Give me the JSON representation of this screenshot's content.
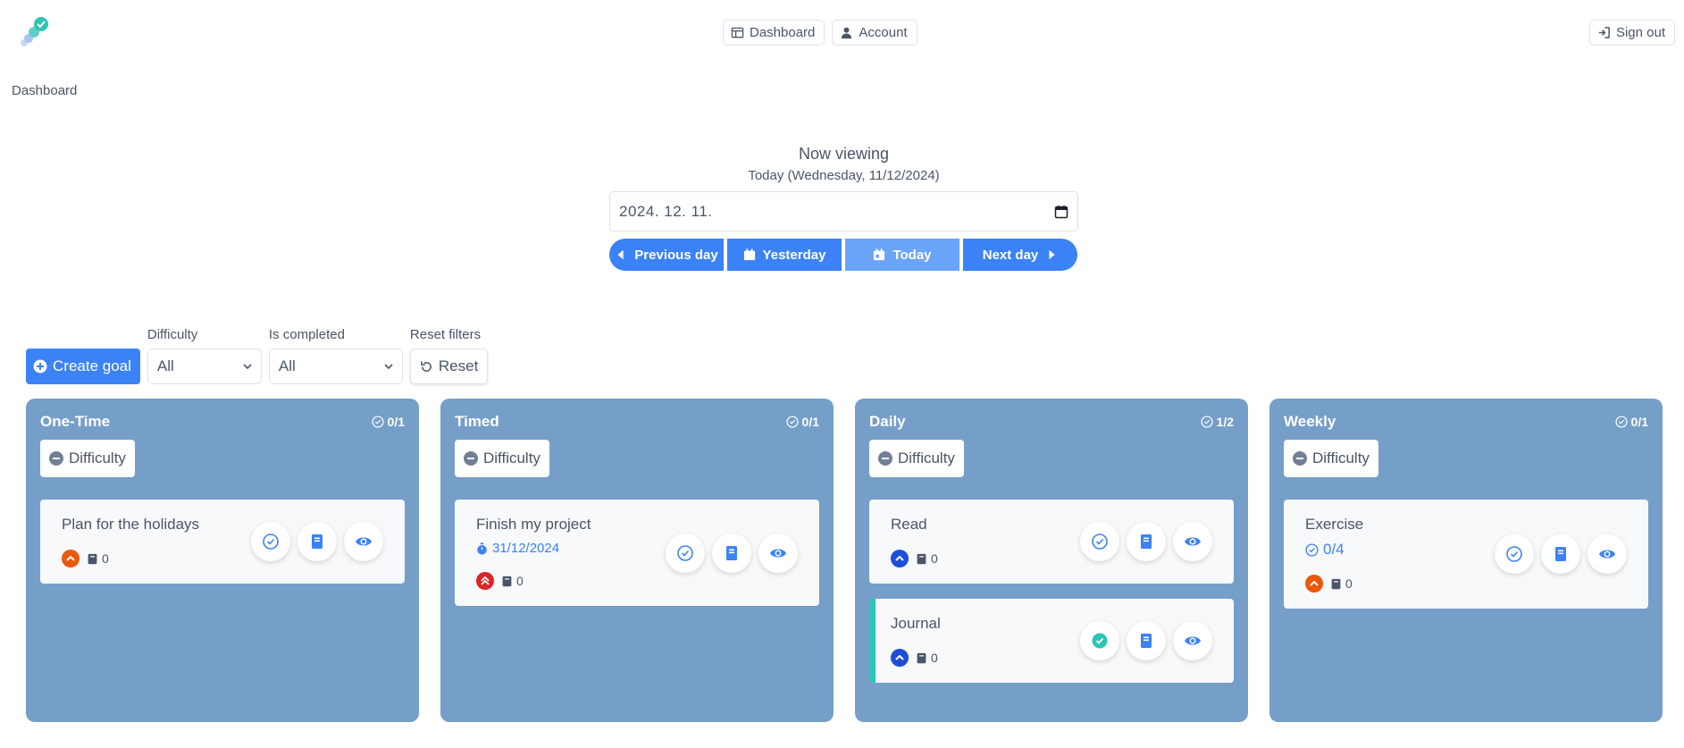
{
  "nav": {
    "dashboard_label": "Dashboard",
    "account_label": "Account",
    "signout_label": "Sign out"
  },
  "breadcrumb": "Dashboard",
  "viewer": {
    "heading": "Now viewing",
    "subheading": "Today (Wednesday, 11/12/2024)",
    "date_value": "2024. 12. 11.",
    "buttons": {
      "prev": "Previous day",
      "yesterday": "Yesterday",
      "today": "Today",
      "next": "Next day"
    }
  },
  "filters": {
    "create_label": "Create goal",
    "difficulty_label": "Difficulty",
    "difficulty_value": "All",
    "completed_label": "Is completed",
    "completed_value": "All",
    "reset_filters_label": "Reset filters",
    "reset_label": "Reset"
  },
  "colors": {
    "accent": "#3b82f6",
    "column_bg": "#759fc9",
    "orange": "#ea580c",
    "red": "#dc2626",
    "blue": "#1d4ed8",
    "teal": "#2ec4b6"
  },
  "columns": [
    {
      "title": "One-Time",
      "count": "0/1",
      "difficulty_label": "Difficulty",
      "cards": [
        {
          "title": "Plan for the holidays",
          "notes": "0",
          "priority": "high",
          "done": false
        }
      ]
    },
    {
      "title": "Timed",
      "count": "0/1",
      "difficulty_label": "Difficulty",
      "cards": [
        {
          "title": "Finish my project",
          "due": "31/12/2024",
          "notes": "0",
          "priority": "urgent",
          "done": false
        }
      ]
    },
    {
      "title": "Daily",
      "count": "1/2",
      "difficulty_label": "Difficulty",
      "cards": [
        {
          "title": "Read",
          "notes": "0",
          "priority": "medium",
          "done": false
        },
        {
          "title": "Journal",
          "notes": "0",
          "priority": "medium",
          "done": true
        }
      ]
    },
    {
      "title": "Weekly",
      "count": "0/1",
      "difficulty_label": "Difficulty",
      "cards": [
        {
          "title": "Exercise",
          "progress": "0/4",
          "notes": "0",
          "priority": "high",
          "done": false
        }
      ]
    }
  ]
}
